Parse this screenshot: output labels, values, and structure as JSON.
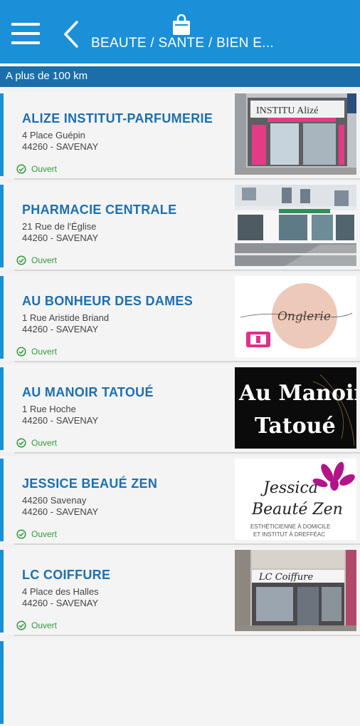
{
  "header": {
    "title": "BEAUTE / SANTE / BIEN E...",
    "menu_icon": "hamburger-menu-icon",
    "back_icon": "chevron-left-icon",
    "category_icon": "shopping-bag-icon",
    "color": "#1b8fd8"
  },
  "distance_label": "A plus de 100 km",
  "status_open": "Ouvert",
  "shops": [
    {
      "name": "ALIZE INSTITUT-PARFUMERIE",
      "address": "4 Place Guépin",
      "city": "44260 - SAVENAY",
      "status": "Ouvert",
      "image_text": "INSTITU Alizé"
    },
    {
      "name": "PHARMACIE CENTRALE",
      "address": "21 Rue de l'Église",
      "city": "44260 - SAVENAY",
      "status": "Ouvert"
    },
    {
      "name": "AU BONHEUR DES DAMES",
      "address": "1 Rue Aristide Briand",
      "city": "44260 - SAVENAY",
      "status": "Ouvert",
      "image_text": "Onglerie"
    },
    {
      "name": "AU MANOIR TATOUÉ",
      "address": "1 Rue Hoche",
      "city": "44260 - SAVENAY",
      "status": "Ouvert",
      "image_text": [
        "Au Manoir",
        "Tatoué"
      ]
    },
    {
      "name": "JESSICE BEAUÉ ZEN",
      "address": "44260 Savenay",
      "city": "44260 - SAVENAY",
      "status": "Ouvert",
      "image_text": [
        "Jessica",
        "Beauté Zen",
        "ESTHÉTICIENNE À DOMICILE",
        "ET INSTITUT À DREFFÉAC"
      ]
    },
    {
      "name": "LC COIFFURE",
      "address": "4 Place des Halles",
      "city": "44260 - SAVENAY",
      "status": "Ouvert",
      "image_text": "LC Coiffure"
    }
  ]
}
